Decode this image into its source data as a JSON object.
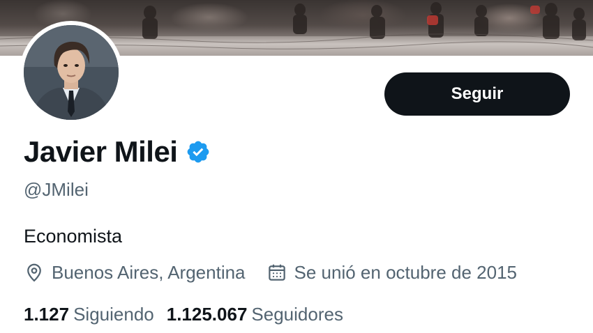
{
  "profile": {
    "display_name": "Javier Milei",
    "handle": "@JMilei",
    "bio": "Economista",
    "verified": true,
    "verified_badge_color": "#1d9bf0",
    "location": "Buenos Aires, Argentina",
    "joined": "Se unió en octubre de 2015"
  },
  "actions": {
    "follow_label": "Seguir"
  },
  "stats": {
    "following_count": "1.127",
    "following_label": "Siguiendo",
    "followers_count": "1.125.067",
    "followers_label": "Seguidores"
  },
  "icons": {
    "location": "location-pin-icon",
    "joined": "calendar-icon",
    "verified": "verified-badge-icon"
  },
  "colors": {
    "text_primary": "#0f1419",
    "text_secondary": "#536471",
    "button_bg": "#0f1419",
    "button_text": "#ffffff"
  }
}
